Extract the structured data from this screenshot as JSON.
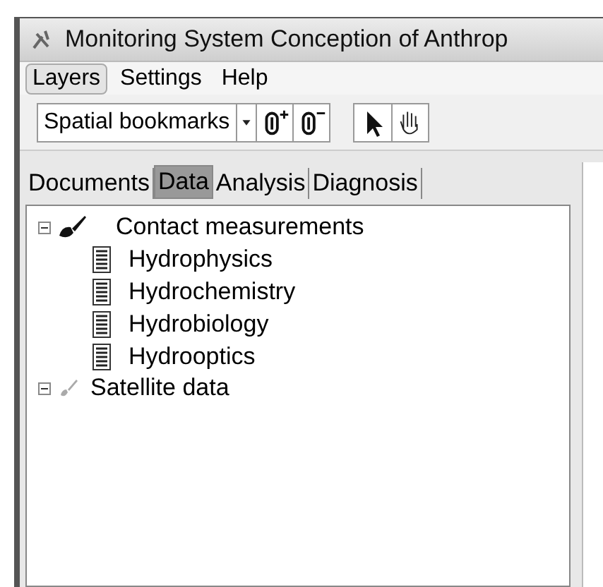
{
  "window": {
    "title": "Monitoring System Conception of Anthrop"
  },
  "menu": [
    {
      "label": "Layers",
      "selected": true
    },
    {
      "label": "Settings",
      "selected": false
    },
    {
      "label": "Help",
      "selected": false
    }
  ],
  "toolbar": {
    "bookmarks": {
      "value": "Spatial bookmarks"
    }
  },
  "tabs": [
    {
      "label": "Documents",
      "selected": false
    },
    {
      "label": "Data",
      "selected": true
    },
    {
      "label": "Analysis",
      "selected": false
    },
    {
      "label": "Diagnosis",
      "selected": false
    }
  ],
  "tree": [
    {
      "label": "Contact measurements",
      "kind": "probe",
      "expanded": true,
      "children": [
        {
          "label": "Hydrophysics",
          "kind": "document"
        },
        {
          "label": "Hydrochemistry",
          "kind": "document"
        },
        {
          "label": "Hydrobiology",
          "kind": "document"
        },
        {
          "label": "Hydrooptics",
          "kind": "document"
        }
      ]
    },
    {
      "label": "Satellite data",
      "kind": "satellite",
      "expanded": true
    }
  ]
}
